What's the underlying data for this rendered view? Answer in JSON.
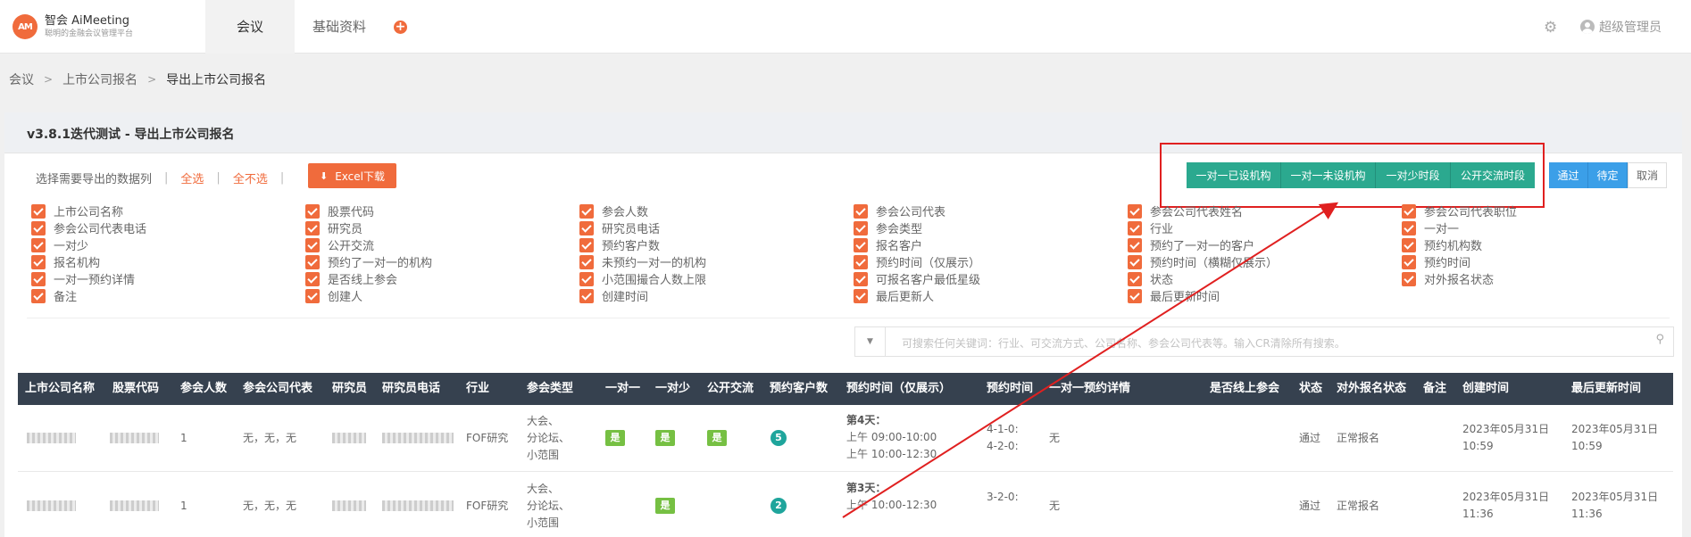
{
  "header": {
    "logo_mark": "AM",
    "logo_name": "智会 AiMeeting",
    "logo_sub": "聪明的金融会议管理平台",
    "tabs": [
      {
        "label": "会议"
      },
      {
        "label": "基础资料"
      }
    ],
    "add_icon": "plus-circle-icon",
    "add_glyph": "+",
    "settings_icon": "gear-icon",
    "user_icon": "user-avatar-icon",
    "user_name": "超级管理员"
  },
  "breadcrumb": [
    "会议",
    "上市公司报名",
    "导出上市公司报名"
  ],
  "panel": {
    "title": "v3.8.1迭代测试 - 导出上市公司报名"
  },
  "toolbar": {
    "hint": "选择需要导出的数据列",
    "select_all": "全选",
    "select_none": "全不选",
    "excel_label": "Excel下载",
    "excel_icon": "download-icon"
  },
  "filter_buttons": [
    "一对一已设机构",
    "一对一未设机构",
    "一对少时段",
    "公开交流时段"
  ],
  "status_buttons": [
    "通过",
    "待定"
  ],
  "cancel_label": "取消",
  "columns_selector": [
    [
      "上市公司名称",
      "股票代码",
      "参会人数",
      "参会公司代表",
      "参会公司代表姓名",
      "参会公司代表职位"
    ],
    [
      "参会公司代表电话",
      "研究员",
      "研究员电话",
      "参会类型",
      "行业",
      "一对一"
    ],
    [
      "一对少",
      "公开交流",
      "预约客户数",
      "报名客户",
      "预约了一对一的客户",
      "预约机构数"
    ],
    [
      "报名机构",
      "预约了一对一的机构",
      "未预约一对一的机构",
      "预约时间（仅展示）",
      "预约时间（横糊仅展示）",
      "预约时间"
    ],
    [
      "一对一预约详情",
      "是否线上参会",
      "小范围撮合人数上限",
      "可报名客户最低星级",
      "状态",
      "对外报名状态"
    ],
    [
      "备注",
      "创建人",
      "创建时间",
      "最后更新人",
      "最后更新时间"
    ]
  ],
  "search": {
    "placeholder": "可搜索任何关键词：行业、可交流方式、公司名称、参会公司代表等。输入CR清除所有搜索。",
    "dropdown_glyph": "▼",
    "search_icon": "magnifier-icon",
    "search_glyph": "⚲"
  },
  "table": {
    "headers": [
      "上市公司名称",
      "股票代码",
      "参会人数",
      "参会公司代表",
      "研究员",
      "研究员电话",
      "行业",
      "参会类型",
      "一对一",
      "一对少",
      "公开交流",
      "预约客户数",
      "预约时间（仅展示）",
      "预约时间",
      "一对一预约详情",
      "是否线上参会",
      "状态",
      "对外报名状态",
      "备注",
      "创建时间",
      "最后更新时间"
    ],
    "rows": [
      {
        "attendees": "1",
        "reps": "无，无，无",
        "industry": "FOF研究",
        "type": [
          "大会、",
          "分论坛、",
          "小范围"
        ],
        "one_on_one": "是",
        "one_on_few": "是",
        "public": "是",
        "clients": "5",
        "time_day": "第4天：",
        "time_slots": [
          "上午 09:00-10:00",
          "上午 10:00-12:30"
        ],
        "time_raw": [
          "4-1-0:",
          "4-2-0:"
        ],
        "detail": "无",
        "status": "通过",
        "ext_status": "正常报名",
        "created": [
          "2023年05月31日",
          "10:59"
        ],
        "updated": [
          "2023年05月31日",
          "10:59"
        ]
      },
      {
        "attendees": "1",
        "reps": "无，无，无",
        "industry": "FOF研究",
        "type": [
          "大会、",
          "分论坛、",
          "小范围"
        ],
        "one_on_one": "",
        "one_on_few": "是",
        "public": "",
        "clients": "2",
        "time_day": "第3天：",
        "time_slots": [
          "上午 10:00-12:30"
        ],
        "time_raw": [
          "3-2-0:"
        ],
        "detail": "无",
        "status": "通过",
        "ext_status": "正常报名",
        "created": [
          "2023年05月31日",
          "11:36"
        ],
        "updated": [
          "2023年05月31日",
          "11:36"
        ]
      }
    ]
  },
  "colors": {
    "accent": "#f06b3c",
    "teal": "#2ba98f",
    "blue": "#3b9fe8",
    "header_bg": "#36414f",
    "annotation_red": "#e02020"
  }
}
